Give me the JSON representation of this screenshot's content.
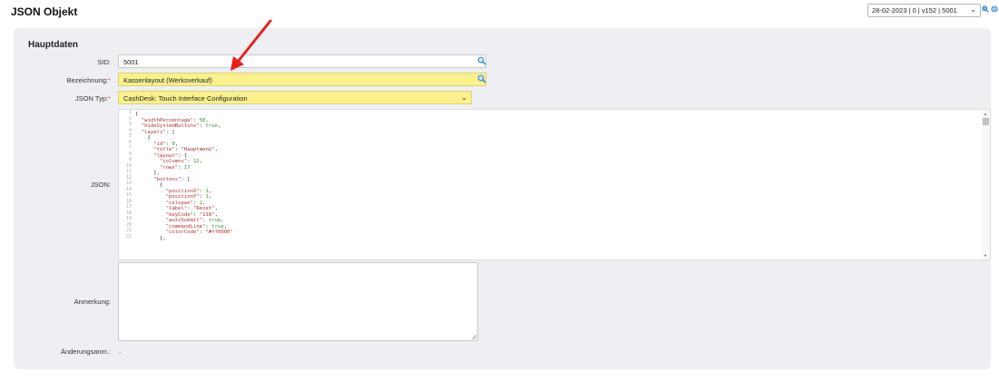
{
  "page": {
    "title": "JSON Objekt"
  },
  "header": {
    "version_select": "28-02-2023 | 0 | v152 | 5001"
  },
  "panel": {
    "title": "Hauptdaten"
  },
  "fields": {
    "sid": {
      "label": "SID:",
      "value": "5001"
    },
    "bezeichnung": {
      "label": "Bezeichnung:",
      "required_mark": "*",
      "value": "Kassenlayout (Werksverkauf)"
    },
    "json_typ": {
      "label": "JSON Typ:",
      "required_mark": "*",
      "value": "CashDesk: Touch Interface Configuration"
    },
    "json": {
      "label": "JSON:"
    },
    "anmerkung": {
      "label": "Anmerkung:",
      "value": ""
    },
    "aenderung": {
      "label": "Änderungsanm.:",
      "value": "."
    }
  },
  "json_lines": [
    "{",
    "  \"widthPercentage\": 50,",
    "  \"hideSystemButtons\": true,",
    "  \"layers\": [",
    "    {",
    "      \"id\": 0,",
    "      \"title\": \"Hauptmenü\",",
    "      \"layout\": {",
    "        \"columns\": 12,",
    "        \"rows\": 17",
    "      },",
    "      \"buttons\": [",
    "        {",
    "          \"positionX\": 1,",
    "          \"positionY\": 1,",
    "          \"colspan\": 2,",
    "          \"label\": \"Reset\",",
    "          \"keyCode\": \"118\",",
    "          \"autoSubmit\": true,",
    "          \"commandLine\": true,",
    "          \"colorCode\": \"#ff0000\"",
    "        },"
  ],
  "line_numbers": [
    "1",
    "2",
    "3",
    "4",
    "5",
    "6",
    "7",
    "8",
    "9",
    "10",
    "11",
    "12",
    "13",
    "14",
    "15",
    "16",
    "17",
    "18",
    "19",
    "20",
    "21",
    "22"
  ],
  "colors": {
    "required_fill": "#faf18d",
    "panel_bg": "#eeeff2",
    "annotation_arrow": "#e8201c",
    "search_icon": "#3a8fd6"
  },
  "icons": [
    "search-icon",
    "zoom-in-icon",
    "globe-icon",
    "chevron-down-icon",
    "resize-grip-icon",
    "annotation-arrow-icon"
  ]
}
